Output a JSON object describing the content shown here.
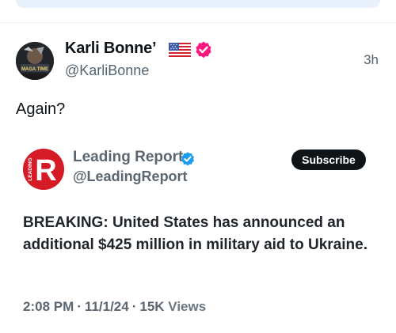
{
  "post": {
    "author_name": "Karli Bonne’",
    "author_handle": "@KarliBonne",
    "timestamp": "3h",
    "text": "Again?",
    "avatar_caption": "MAGA TIME"
  },
  "quote": {
    "author_name": "Leading Report",
    "author_handle": "@LeadingReport",
    "subscribe_label": "Subscribe",
    "avatar_letter": "R",
    "avatar_word": "LEADING",
    "text": "BREAKING: United States has announced an additional $425 million in military aid to Ukraine.",
    "time": "2:08 PM",
    "date": "11/1/24",
    "views_count": "15K",
    "views_label": "Views",
    "separator": "·"
  },
  "colors": {
    "verified_pink": "#f91880",
    "verified_blue": "#1d9bf0",
    "leading_red": "#d51b26",
    "text_primary": "#0f1419",
    "text_secondary": "#536471"
  },
  "icons": {
    "flag": "us-flag-icon",
    "verified_outer": "verified-badge-icon",
    "verified_quote": "verified-badge-icon"
  }
}
